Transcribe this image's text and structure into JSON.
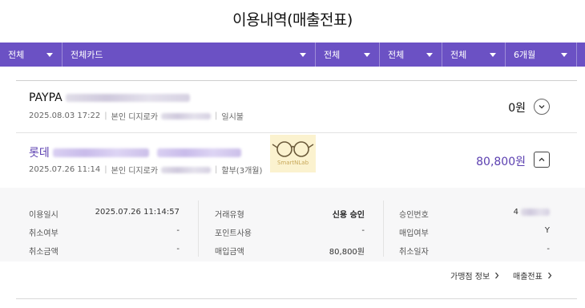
{
  "page": {
    "title": "이용내역(매출전표)"
  },
  "filters": [
    {
      "label": "전체"
    },
    {
      "label": "전체카드"
    },
    {
      "label": "전체"
    },
    {
      "label": "전체"
    },
    {
      "label": "전체"
    },
    {
      "label": "6개월"
    }
  ],
  "transactions": [
    {
      "merchant": "PAYPA",
      "datetime": "2025.08.03 17:22",
      "card": "본인 디지로카",
      "installment": "일시불",
      "amount": "0원",
      "expanded": false
    },
    {
      "merchant": "롯데",
      "datetime": "2025.07.26 11:14",
      "card": "본인 디지로카",
      "installment": "할부(3개월)",
      "amount": "80,800원",
      "expanded": true
    }
  ],
  "watermark": {
    "text": "SmartNLab"
  },
  "details": {
    "col1": [
      {
        "label": "이용일시",
        "value": "2025.07.26 11:14:57"
      },
      {
        "label": "취소여부",
        "value": "-"
      },
      {
        "label": "취소금액",
        "value": "-"
      }
    ],
    "col2": [
      {
        "label": "거래유형",
        "value": "신용 승인"
      },
      {
        "label": "포인트사용",
        "value": "-"
      },
      {
        "label": "매입금액",
        "value": "80,800원"
      }
    ],
    "col3": [
      {
        "label": "승인번호",
        "value": "4"
      },
      {
        "label": "매입여부",
        "value": "Y"
      },
      {
        "label": "취소일자",
        "value": "-"
      }
    ]
  },
  "links": {
    "merchant_info": "가맹점 정보",
    "receipt": "매출전표"
  },
  "colors": {
    "accent": "#6b51c4",
    "merchant_purple": "#5b3fb0"
  }
}
